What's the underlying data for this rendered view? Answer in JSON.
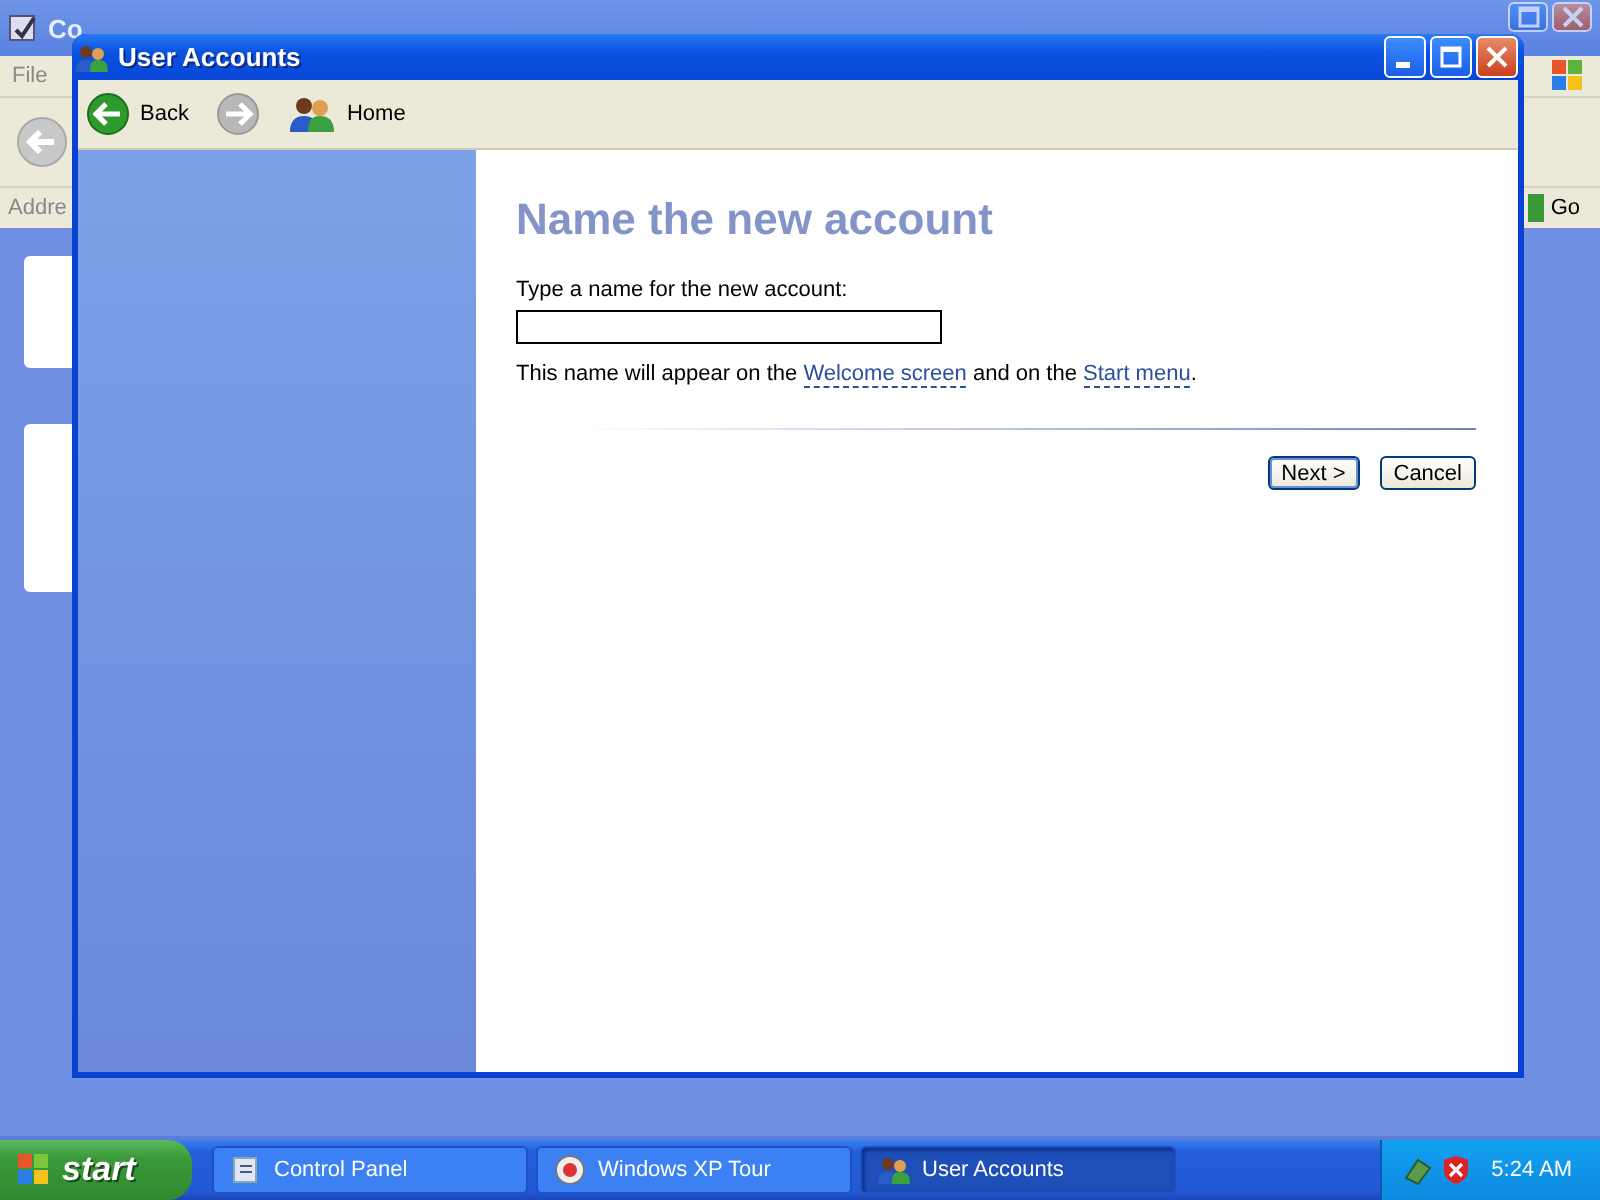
{
  "background_window": {
    "title": "Co",
    "menu": [
      "File"
    ],
    "address_label": "Addre",
    "go_button": "Go"
  },
  "window": {
    "title": "User Accounts",
    "toolbar": [
      {
        "kind": "back",
        "label": "Back",
        "disabled": false
      },
      {
        "kind": "forward",
        "disabled": true
      },
      {
        "kind": "home",
        "label": "Home",
        "disabled": false
      }
    ],
    "page": {
      "heading": "Name the new account",
      "prompt": "Type a name for the new account:",
      "hint": [
        {
          "kind": "text",
          "text": "This name will appear on the "
        },
        {
          "kind": "link",
          "text": "Welcome screen"
        },
        {
          "kind": "text",
          "text": " and on the "
        },
        {
          "kind": "link",
          "text": "Start menu"
        },
        {
          "kind": "text",
          "text": "."
        }
      ],
      "buttons": [
        {
          "label": "Next >",
          "default": true
        },
        {
          "label": "Cancel",
          "default": false
        }
      ]
    }
  },
  "taskbar": {
    "start": "start",
    "tasks": [
      {
        "kind": "folder",
        "label": "Control Panel",
        "selected": false
      },
      {
        "kind": "tour",
        "label": "Windows XP Tour",
        "selected": false
      },
      {
        "kind": "users",
        "label": "User Accounts",
        "selected": true
      }
    ],
    "clock": "5:24 AM"
  }
}
